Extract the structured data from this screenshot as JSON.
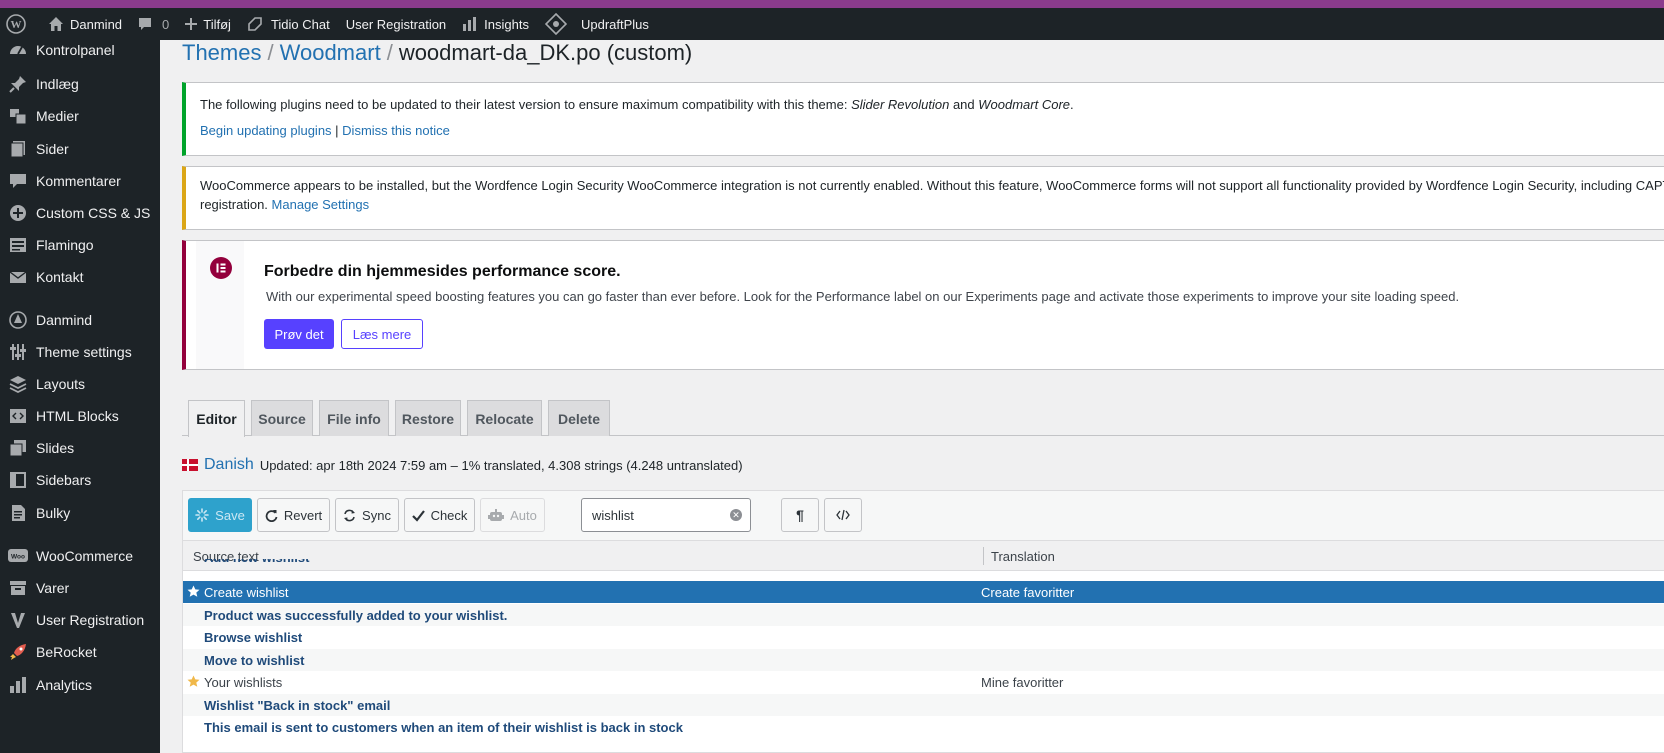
{
  "admin_bar": {
    "site_name": "Danmind",
    "comments_count": "0",
    "new_label": "Tilføj",
    "tidio_label": "Tidio Chat",
    "user_registration_label": "User Registration",
    "insights_label": "Insights",
    "updraft_label": "UpdraftPlus"
  },
  "sidebar": {
    "items": [
      {
        "label": "Kontrolpanel",
        "icon": "dashboard-icon"
      },
      {
        "label": "Indlæg",
        "icon": "pin-icon"
      },
      {
        "label": "Medier",
        "icon": "media-icon"
      },
      {
        "label": "Sider",
        "icon": "pages-icon"
      },
      {
        "label": "Kommentarer",
        "icon": "comment-icon"
      },
      {
        "label": "Custom CSS & JS",
        "icon": "plus-circle-icon"
      },
      {
        "label": "Flamingo",
        "icon": "feed-icon"
      },
      {
        "label": "Kontakt",
        "icon": "mail-icon"
      },
      {
        "label": "Danmind",
        "icon": "tree-icon"
      },
      {
        "label": "Theme settings",
        "icon": "sliders-icon"
      },
      {
        "label": "Layouts",
        "icon": "layers-icon"
      },
      {
        "label": "HTML Blocks",
        "icon": "code-block-icon"
      },
      {
        "label": "Slides",
        "icon": "slides-icon"
      },
      {
        "label": "Sidebars",
        "icon": "sidebar-icon"
      },
      {
        "label": "Bulky",
        "icon": "document-icon"
      },
      {
        "label": "WooCommerce",
        "icon": "woo-icon"
      },
      {
        "label": "Varer",
        "icon": "archive-icon"
      },
      {
        "label": "User Registration",
        "icon": "user-reg-icon"
      },
      {
        "label": "BeRocket",
        "icon": "rocket-icon"
      },
      {
        "label": "Analytics",
        "icon": "chart-bar-icon"
      }
    ]
  },
  "breadcrumb": {
    "part1": "Themes",
    "part2": "Woodmart",
    "current": "woodmart-da_DK.po (custom)",
    "separator": "/"
  },
  "notice_plugins": {
    "text_before": "The following plugins need to be updated to their latest version to ensure maximum compatibility with this theme: ",
    "plugin1": "Slider Revolution",
    "and": " and ",
    "plugin2": "Woodmart Core",
    "period": ".",
    "link_update": "Begin updating plugins",
    "pipe": " | ",
    "link_dismiss": "Dismiss this notice"
  },
  "notice_wordfence": {
    "text": "WooCommerce appears to be installed, but the Wordfence Login Security WooCommerce integration is not currently enabled. Without this feature, WooCommerce forms will not support all functionality provided by Wordfence Login Security, including CAPT",
    "text2": "registration.",
    "link": "Manage Settings"
  },
  "notice_elementor": {
    "title": "Forbedre din hjemmesides performance score.",
    "description": "With our experimental speed boosting features you can go faster than ever before. Look for the Performance label on our Experiments page and activate those experiments to improve your site loading speed.",
    "primary_button": "Prøv det",
    "secondary_button": "Læs mere"
  },
  "tabs": [
    "Editor",
    "Source",
    "File info",
    "Restore",
    "Relocate",
    "Delete"
  ],
  "language": {
    "name": "Danish",
    "meta": "Updated: apr 18th 2024 7:59 am – 1% translated, 4.308 strings (4.248 untranslated)"
  },
  "toolbar": {
    "save": "Save",
    "revert": "Revert",
    "sync": "Sync",
    "check": "Check",
    "auto": "Auto",
    "search_value": "wishlist"
  },
  "grid": {
    "col_source": "Source text",
    "col_translation": "Translation",
    "partial_row": "Add new wishlist",
    "rows": [
      {
        "source": "Create wishlist",
        "translation": "Create favoritter",
        "starred": true,
        "selected": true
      },
      {
        "source": "Product was successfully added to your wishlist.",
        "translation": "",
        "starred": false,
        "selected": false
      },
      {
        "source": "Browse wishlist",
        "translation": "",
        "starred": false,
        "selected": false
      },
      {
        "source": "Move to wishlist",
        "translation": "",
        "starred": false,
        "selected": false
      },
      {
        "source": "Your wishlists",
        "translation": "Mine favoritter",
        "starred": true,
        "selected": false
      },
      {
        "source": "Wishlist \"Back in stock\" email",
        "translation": "",
        "starred": false,
        "selected": false
      },
      {
        "source": "This email is sent to customers when an item of their wishlist is back in stock",
        "translation": "",
        "starred": false,
        "selected": false
      }
    ]
  },
  "colors": {
    "admin_bg": "#1d2327",
    "link": "#2271b1",
    "success": "#00a32a",
    "warning": "#dba617",
    "elementor": "#93003c",
    "elementor_button": "#5741ff",
    "save_button": "#2ea2cc",
    "star_gold": "#f0b849"
  }
}
